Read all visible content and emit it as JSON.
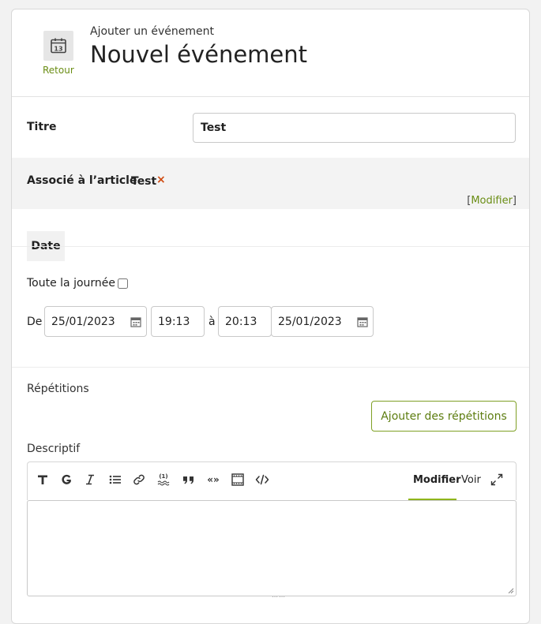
{
  "header": {
    "back_label": "Retour",
    "calendar_day": "13",
    "subtitle": "Ajouter un événement",
    "title": "Nouvel événement"
  },
  "form": {
    "title_label": "Titre",
    "title_value": "Test",
    "association_label": "Associé à l’article",
    "association_value": "Test",
    "remove_symbol": "×",
    "modify_open": "[",
    "modify_label": "Modifier",
    "modify_close": "]"
  },
  "date_section": {
    "tab_label": "Date",
    "all_day_label": "Toute la journée",
    "all_day_checked": false,
    "from_label": "De",
    "start_date": "25/01/2023",
    "start_time": "19:13",
    "to_label": "à",
    "end_time": "20:13",
    "end_date": "25/01/2023"
  },
  "repetitions": {
    "label": "Répétitions",
    "add_button": "Ajouter des répétitions"
  },
  "description": {
    "label": "Descriptif",
    "toolbar_icons": [
      "title-icon",
      "subtitle-icon",
      "italic-icon",
      "list-icon",
      "link-icon",
      "footnote-icon",
      "quote-icon",
      "guillemets-icon",
      "media-icon",
      "code-icon"
    ],
    "tab_edit": "Modifier",
    "tab_preview": "Voir",
    "content": ""
  },
  "colors": {
    "accent": "#6a8d14",
    "remove": "#d04a10",
    "tab_underline": "#8fb51c"
  }
}
